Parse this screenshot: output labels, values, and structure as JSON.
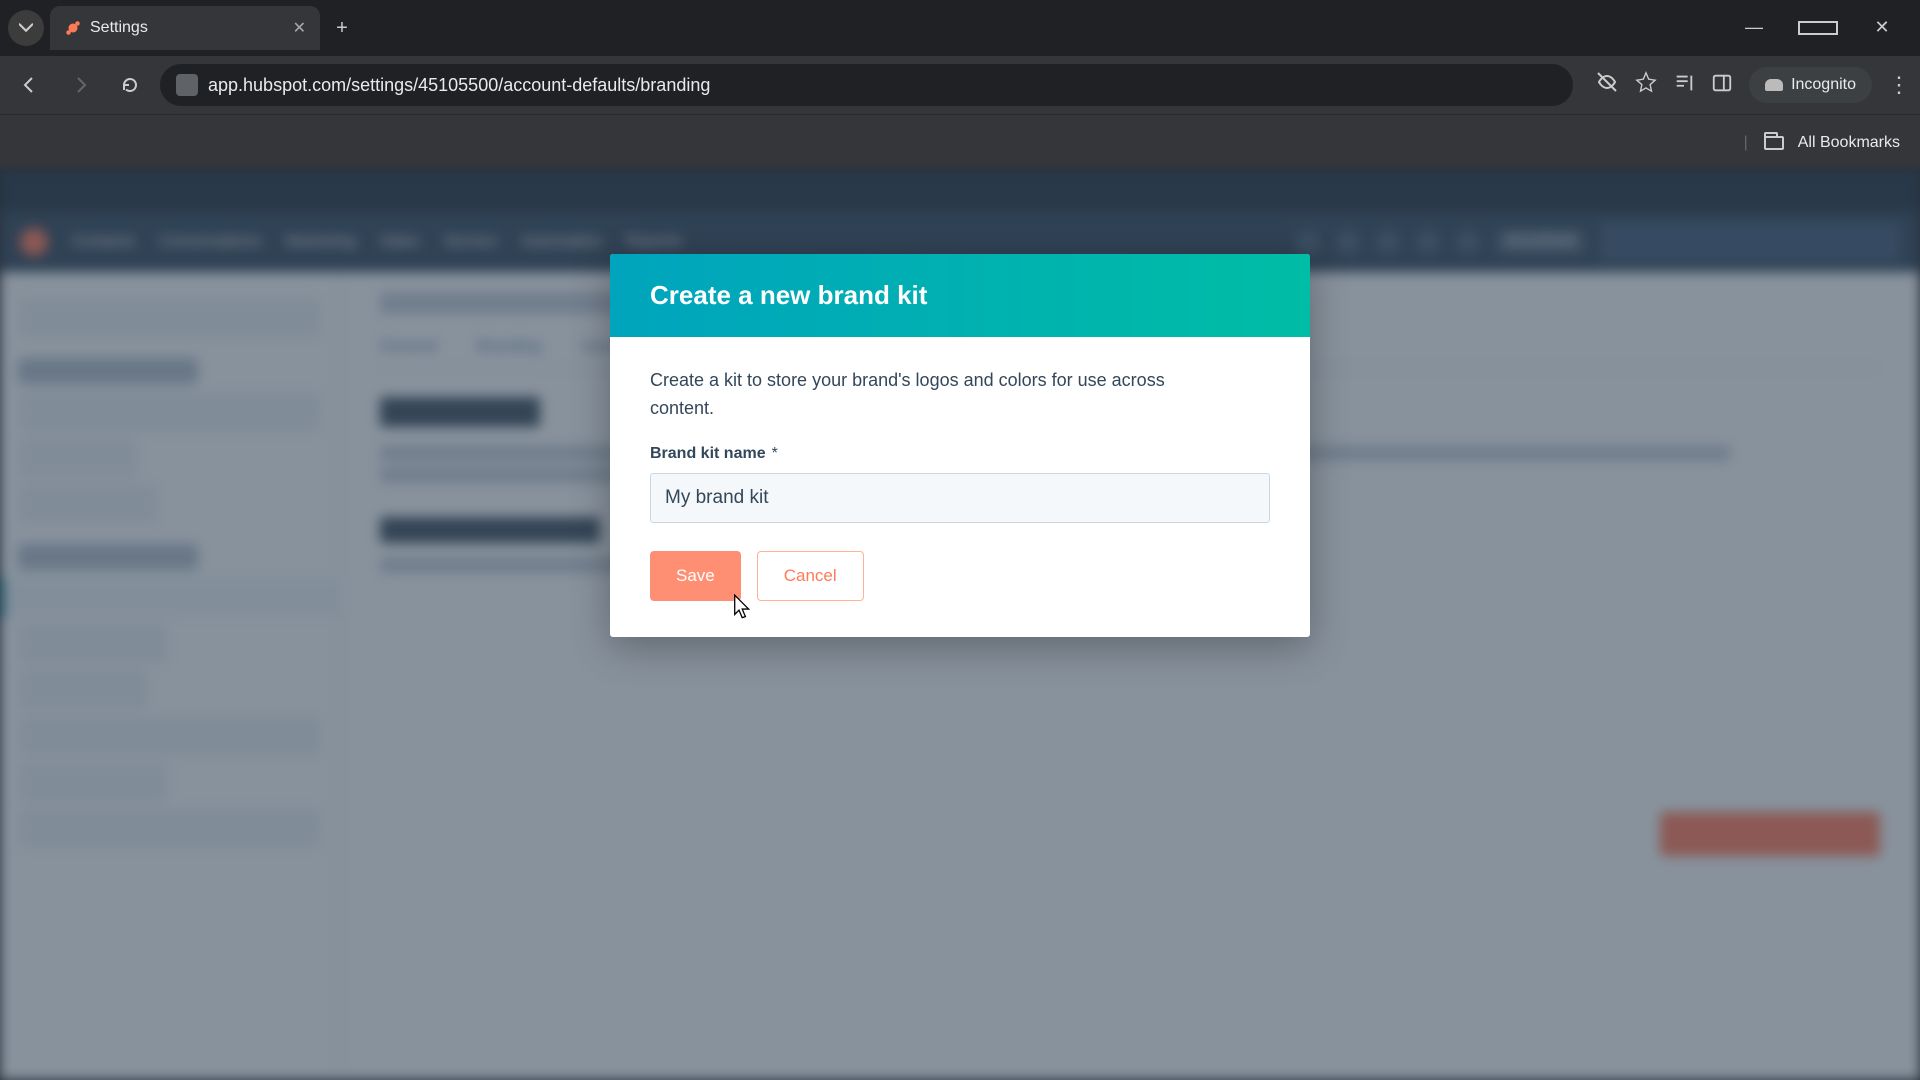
{
  "browser": {
    "tab_title": "Settings",
    "url": "app.hubspot.com/settings/45105500/account-defaults/branding",
    "incognito_label": "Incognito",
    "bookmarks_label": "All Bookmarks"
  },
  "modal": {
    "title": "Create a new brand kit",
    "description": "Create a kit to store your brand's logos and colors for use across content.",
    "field_label": "Brand kit name",
    "required_marker": "*",
    "input_value": "My brand kit",
    "save_label": "Save",
    "cancel_label": "Cancel"
  }
}
